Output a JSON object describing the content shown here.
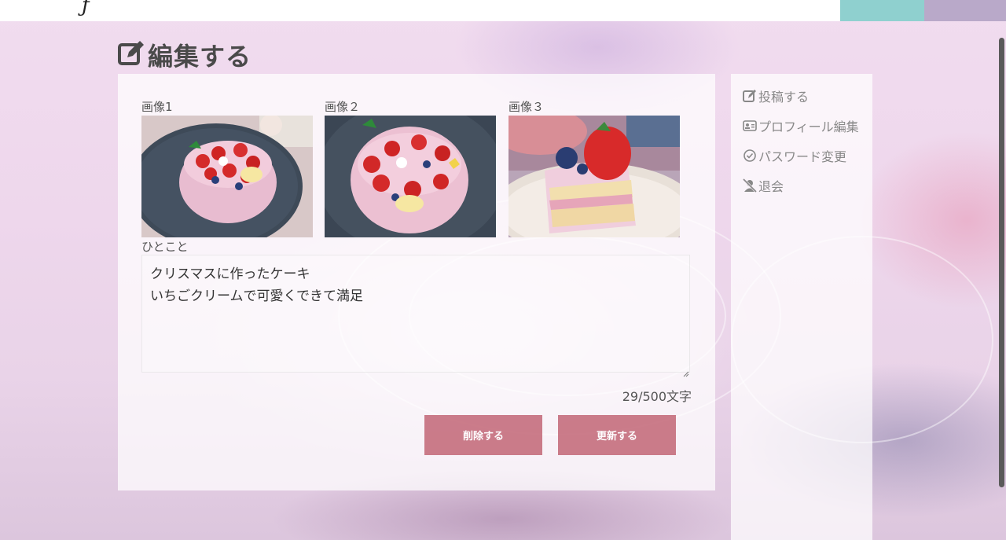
{
  "page": {
    "title": "編集する"
  },
  "images": [
    {
      "label": "画像1"
    },
    {
      "label": "画像２"
    },
    {
      "label": "画像３"
    }
  ],
  "comment": {
    "label": "ひとこと",
    "value": "クリスマスに作ったケーキ\nいちごクリームで可愛くできて満足",
    "counter": "29/500文字"
  },
  "buttons": {
    "delete": "削除する",
    "update": "更新する"
  },
  "sidebar": {
    "items": [
      {
        "label": "投稿する",
        "icon": "edit-icon"
      },
      {
        "label": "プロフィール編集",
        "icon": "id-card-icon"
      },
      {
        "label": "パスワード変更",
        "icon": "check-circle-icon"
      },
      {
        "label": "退会",
        "icon": "user-slash-icon"
      }
    ]
  },
  "colors": {
    "accent_button": "#c66f7e",
    "top_teal": "#8fd0cf",
    "top_lavender": "#b9a9c9"
  }
}
